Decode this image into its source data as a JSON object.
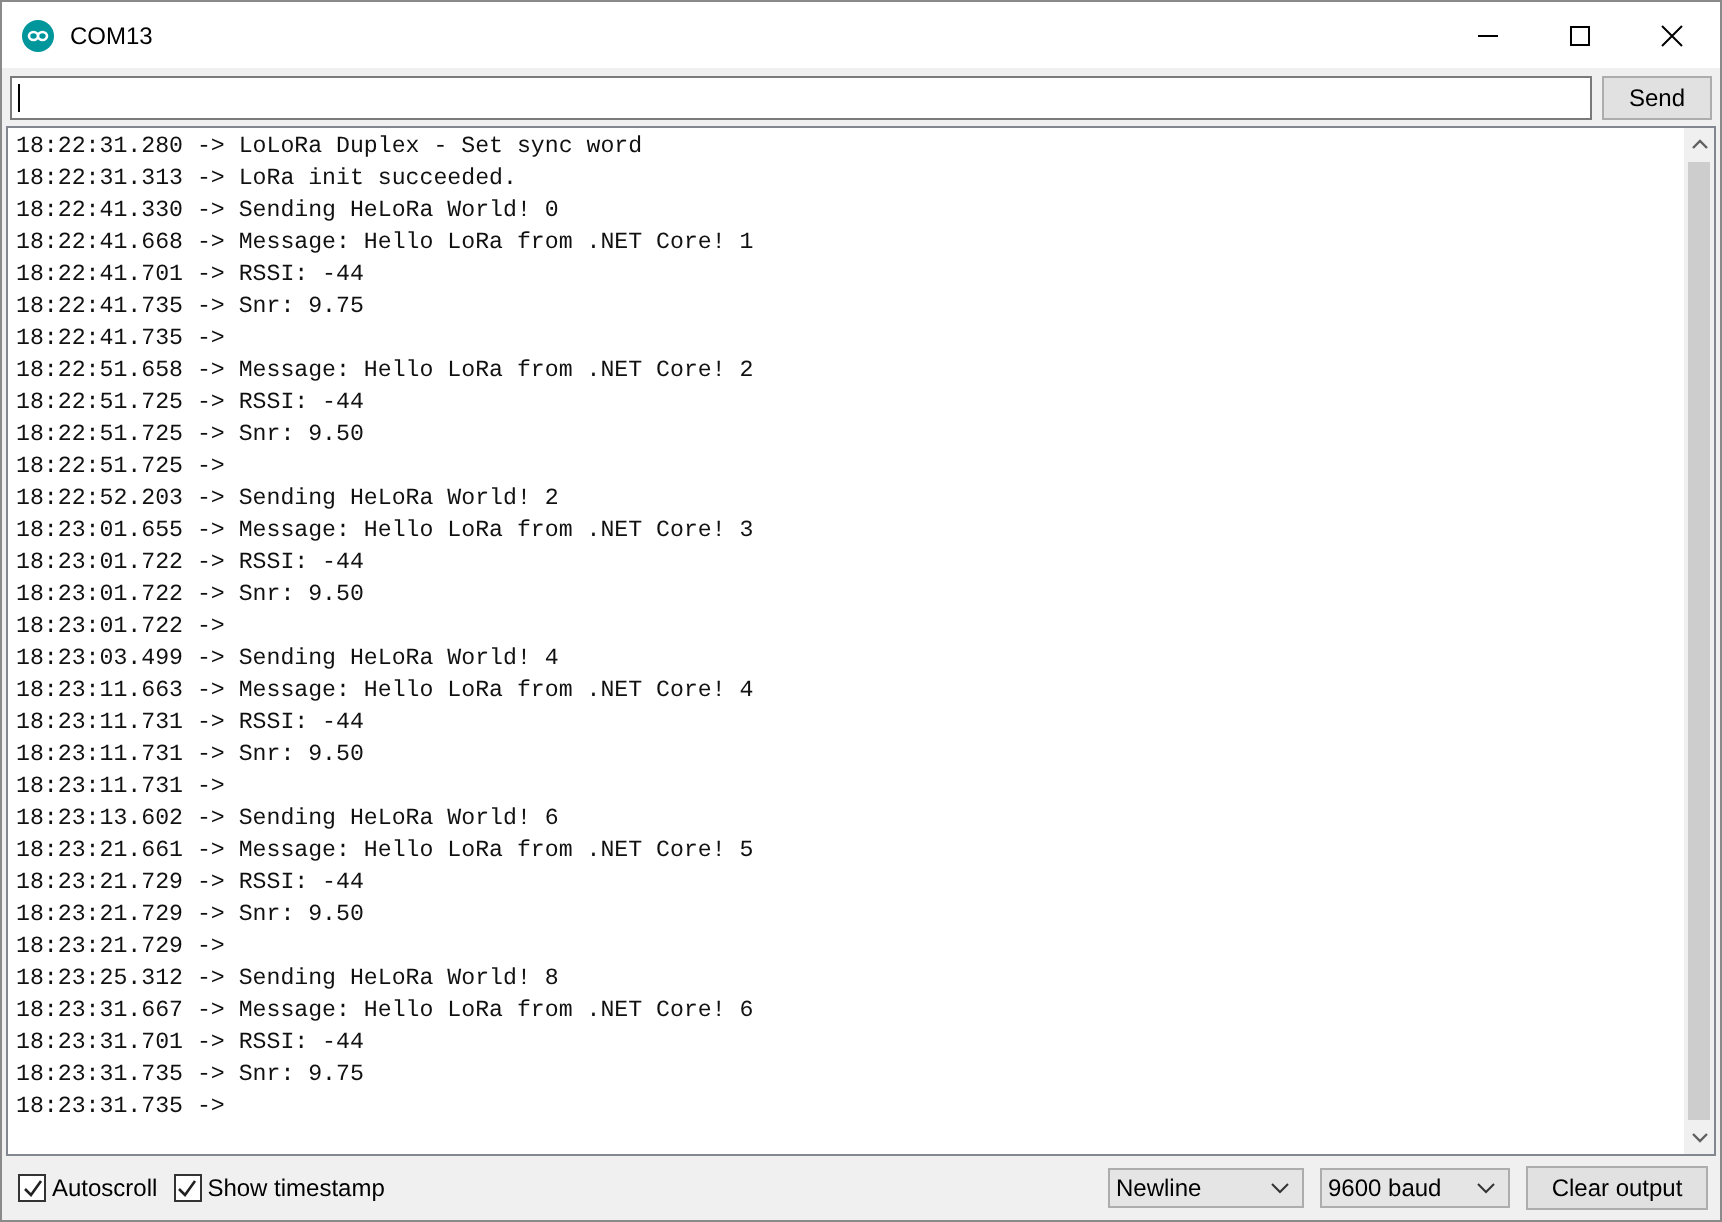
{
  "window": {
    "title": "COM13"
  },
  "send_button": "Send",
  "output_lines": [
    "18:22:31.280 -> LoLoRa Duplex - Set sync word",
    "18:22:31.313 -> LoRa init succeeded.",
    "18:22:41.330 -> Sending HeLoRa World! 0",
    "18:22:41.668 -> Message: Hello LoRa from .NET Core! 1",
    "18:22:41.701 -> RSSI: -44",
    "18:22:41.735 -> Snr: 9.75",
    "18:22:41.735 ->",
    "18:22:51.658 -> Message: Hello LoRa from .NET Core! 2",
    "18:22:51.725 -> RSSI: -44",
    "18:22:51.725 -> Snr: 9.50",
    "18:22:51.725 ->",
    "18:22:52.203 -> Sending HeLoRa World! 2",
    "18:23:01.655 -> Message: Hello LoRa from .NET Core! 3",
    "18:23:01.722 -> RSSI: -44",
    "18:23:01.722 -> Snr: 9.50",
    "18:23:01.722 ->",
    "18:23:03.499 -> Sending HeLoRa World! 4",
    "18:23:11.663 -> Message: Hello LoRa from .NET Core! 4",
    "18:23:11.731 -> RSSI: -44",
    "18:23:11.731 -> Snr: 9.50",
    "18:23:11.731 ->",
    "18:23:13.602 -> Sending HeLoRa World! 6",
    "18:23:21.661 -> Message: Hello LoRa from .NET Core! 5",
    "18:23:21.729 -> RSSI: -44",
    "18:23:21.729 -> Snr: 9.50",
    "18:23:21.729 ->",
    "18:23:25.312 -> Sending HeLoRa World! 8",
    "18:23:31.667 -> Message: Hello LoRa from .NET Core! 6",
    "18:23:31.701 -> RSSI: -44",
    "18:23:31.735 -> Snr: 9.75",
    "18:23:31.735 ->"
  ],
  "checkboxes": [
    {
      "label": "Autoscroll",
      "checked": true
    },
    {
      "label": "Show timestamp",
      "checked": true
    }
  ],
  "line_ending_dropdown": "Newline",
  "baud_dropdown": "9600 baud",
  "clear_button": "Clear output"
}
